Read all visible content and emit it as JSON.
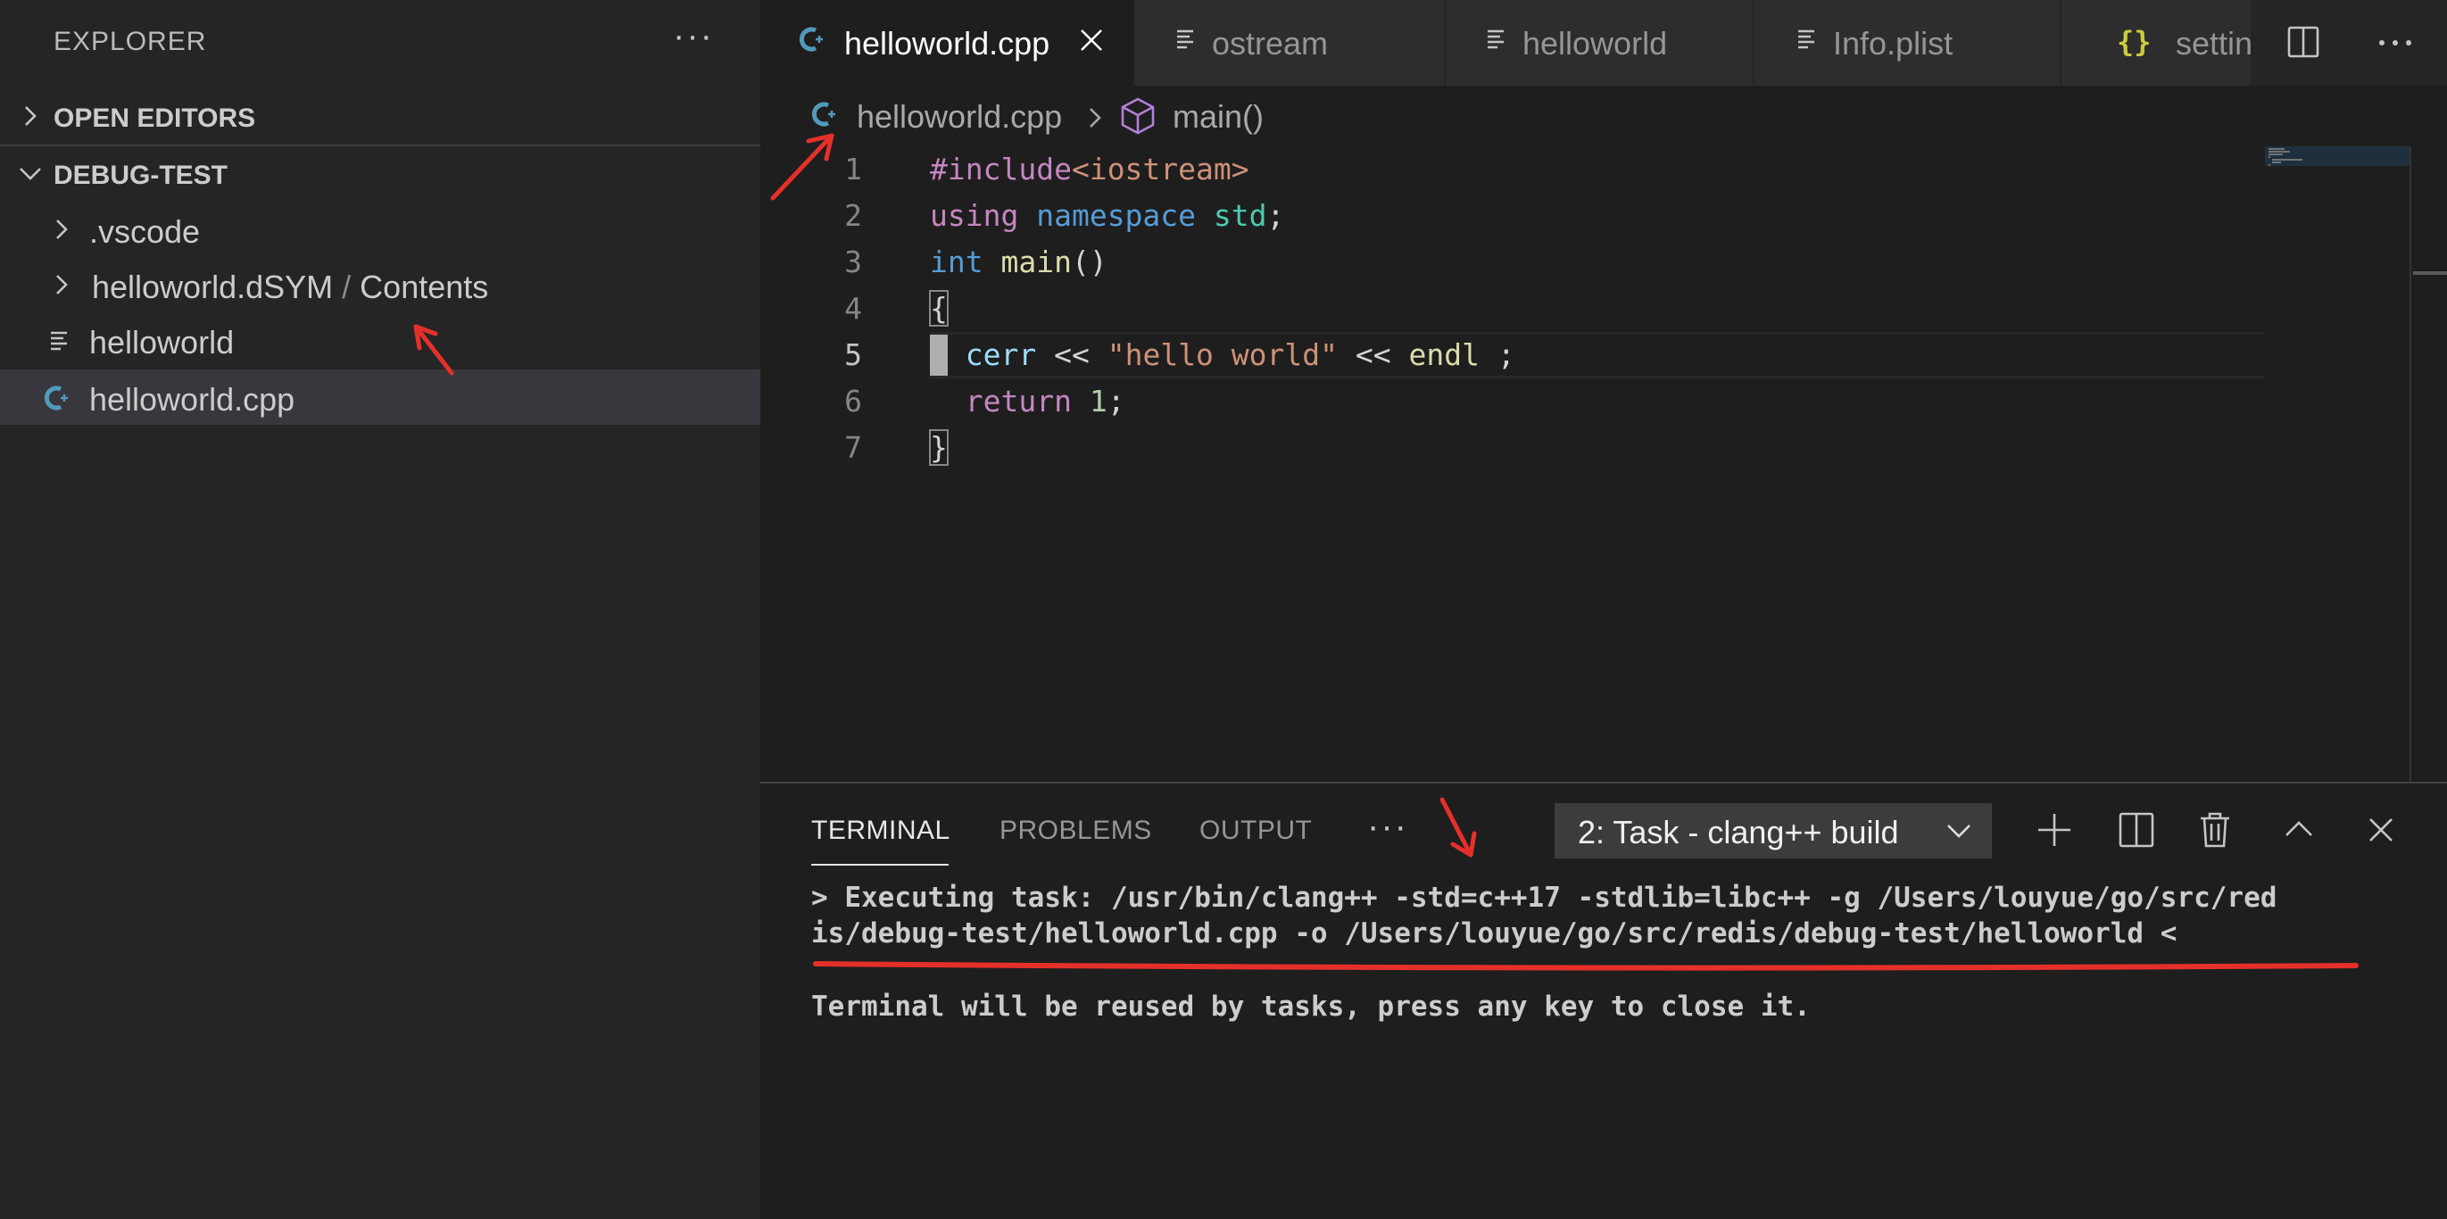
{
  "colors": {
    "accent_cpp_icon": "#519aba",
    "annotation": "#e5302a",
    "json_icon": "#cbcb41"
  },
  "sidebar": {
    "title": "EXPLORER",
    "more": "···",
    "open_editors": "OPEN EDITORS",
    "folder": "DEBUG-TEST",
    "items": [
      {
        "label": ".vscode",
        "type": "folder",
        "icon": "chevron-right-icon"
      },
      {
        "label": "helloworld.dSYM",
        "sep": "/",
        "suffix": "Contents",
        "type": "folder",
        "icon": "chevron-right-icon"
      },
      {
        "label": "helloworld",
        "type": "file",
        "icon": "text-file-icon"
      },
      {
        "label": "helloworld.cpp",
        "type": "file",
        "icon": "cpp-file-icon",
        "selected": true
      }
    ]
  },
  "tabs": [
    {
      "label": "helloworld.cpp",
      "icon": "cpp-file-icon",
      "active": true
    },
    {
      "label": "ostream",
      "icon": "text-file-icon"
    },
    {
      "label": "helloworld",
      "icon": "text-file-icon"
    },
    {
      "label": "Info.plist",
      "icon": "text-file-icon"
    },
    {
      "label": "settings",
      "icon": "json-braces-icon"
    }
  ],
  "breadcrumb": {
    "file": "helloworld.cpp",
    "symbol": "main()"
  },
  "editor": {
    "lines": [
      {
        "n": "1",
        "tokens": [
          [
            "k-pink",
            "#include"
          ],
          [
            "k-str",
            "<iostream>"
          ]
        ]
      },
      {
        "n": "2",
        "tokens": [
          [
            "k-pink",
            "using"
          ],
          [
            "",
            " "
          ],
          [
            "k-blue",
            "namespace"
          ],
          [
            "",
            " "
          ],
          [
            "k-teal",
            "std"
          ],
          [
            "",
            ";"
          ]
        ]
      },
      {
        "n": "3",
        "tokens": [
          [
            "k-blue",
            "int"
          ],
          [
            "",
            " "
          ],
          [
            "k-fn",
            "main"
          ],
          [
            "",
            "()"
          ]
        ]
      },
      {
        "n": "4",
        "tokens": [
          [
            "bracket-box",
            "{"
          ]
        ]
      },
      {
        "n": "5",
        "tokens": [
          [
            "",
            "  "
          ],
          [
            "k-var",
            "cerr"
          ],
          [
            "",
            " << "
          ],
          [
            "k-str",
            "\"hello world\""
          ],
          [
            "",
            " << "
          ],
          [
            "k-fn",
            "endl"
          ],
          [
            "",
            " ;"
          ]
        ]
      },
      {
        "n": "6",
        "tokens": [
          [
            "",
            "  "
          ],
          [
            "k-pink",
            "return"
          ],
          [
            "",
            " "
          ],
          [
            "k-num",
            "1"
          ],
          [
            "",
            ";"
          ]
        ]
      },
      {
        "n": "7",
        "tokens": [
          [
            "bracket-box",
            "}"
          ]
        ]
      }
    ]
  },
  "panel": {
    "tabs": [
      "TERMINAL",
      "PROBLEMS",
      "OUTPUT"
    ],
    "more": "···",
    "terminal_selected": "2: Task - clang++ build",
    "output": [
      "> Executing task: /usr/bin/clang++ -std=c++17 -stdlib=libc++ -g /Users/louyue/go/src/red",
      "is/debug-test/helloworld.cpp -o /Users/louyue/go/src/redis/debug-test/helloworld <",
      "",
      "Terminal will be reused by tasks, press any key to close it."
    ]
  }
}
